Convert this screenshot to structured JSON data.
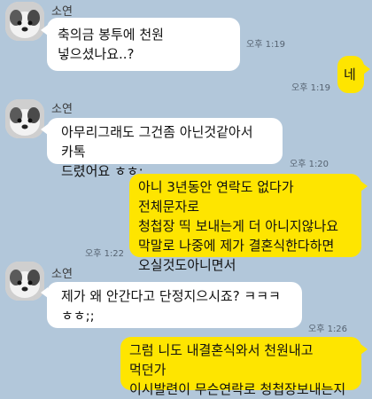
{
  "contact": {
    "name": "소연"
  },
  "messages": [
    {
      "side": "left",
      "text": "축의금 봉투에 천원 넣으셨나요..?",
      "time": "오후 1:19"
    },
    {
      "side": "right",
      "text": "네",
      "time": "오후 1:19"
    },
    {
      "side": "left",
      "text": "아무리그래도 그건좀 아닌것같아서 카톡\n드렸어요 ㅎㅎ;",
      "time": "오후 1:20"
    },
    {
      "side": "right",
      "text": "아니 3년동안 연락도 없다가 전체문자로\n청첩장 띡 보내는게 더 아니지않나요\n막말로 나중에 제가 결혼식한다하면\n오실것도아니면서",
      "time": "오후 1:22"
    },
    {
      "side": "left",
      "text": "제가 왜 안간다고 단정지으시죠? ㅋㅋㅋ\nㅎㅎ;;",
      "time": "오후 1:26"
    },
    {
      "side": "right",
      "text": "그럼 니도 내결혼식와서 천원내고 먹던가\n이시발련이 무슨연락로 청첩장보내는지",
      "time": ""
    }
  ]
}
